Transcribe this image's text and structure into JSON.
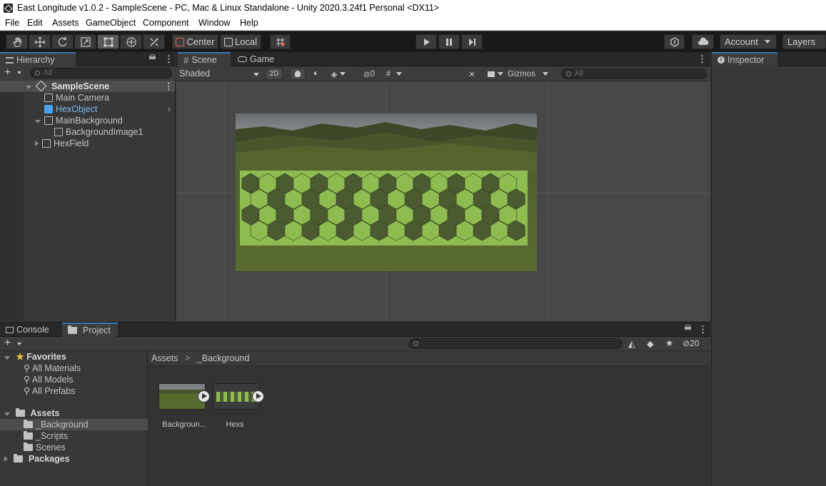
{
  "window": {
    "title": "East Longitude v1.0.2 - SampleScene - PC, Mac & Linux Standalone - Unity 2020.3.24f1 Personal <DX11>"
  },
  "menu": [
    "File",
    "Edit",
    "Assets",
    "GameObject",
    "Component",
    "Window",
    "Help"
  ],
  "toolbar": {
    "pivot": "Center",
    "space": "Local",
    "account": "Account",
    "layers": "Layers"
  },
  "hierarchy": {
    "tab": "Hierarchy",
    "search_placeholder": "All",
    "scene": "SampleScene",
    "items": [
      "Main Camera",
      "HexObject",
      "MainBackground",
      "BackgroundImage1",
      "HexField"
    ]
  },
  "scene": {
    "tabs": [
      "Scene",
      "Game"
    ],
    "shading": "Shaded",
    "mode2d": "2D",
    "hidden_count": "0",
    "gizmos": "Gizmos",
    "search_placeholder": "All"
  },
  "inspector": {
    "tab": "Inspector"
  },
  "bottom": {
    "tabs": [
      "Console",
      "Project"
    ],
    "count": "20"
  },
  "project": {
    "favorites": "Favorites",
    "fav_items": [
      "All Materials",
      "All Models",
      "All Prefabs"
    ],
    "assets": "Assets",
    "asset_folders": [
      "_Background",
      "_Scripts",
      "Scenes"
    ],
    "packages": "Packages",
    "breadcrumb": [
      "Assets",
      "_Background"
    ],
    "files": [
      "Backgroun...",
      "Hexs"
    ]
  },
  "colors": {
    "accent": "#3a79bb",
    "hexobject": "#7db9f2",
    "hex_light": "#8fbc51",
    "hex_dark": "#4c5a32"
  },
  "icons": [
    "hand-icon",
    "move-icon",
    "rotate-icon",
    "scale-icon",
    "rect-icon",
    "transform-icon",
    "custom-tool-icon",
    "play-icon",
    "pause-icon",
    "step-icon",
    "collab-icon",
    "cloud-icon"
  ]
}
